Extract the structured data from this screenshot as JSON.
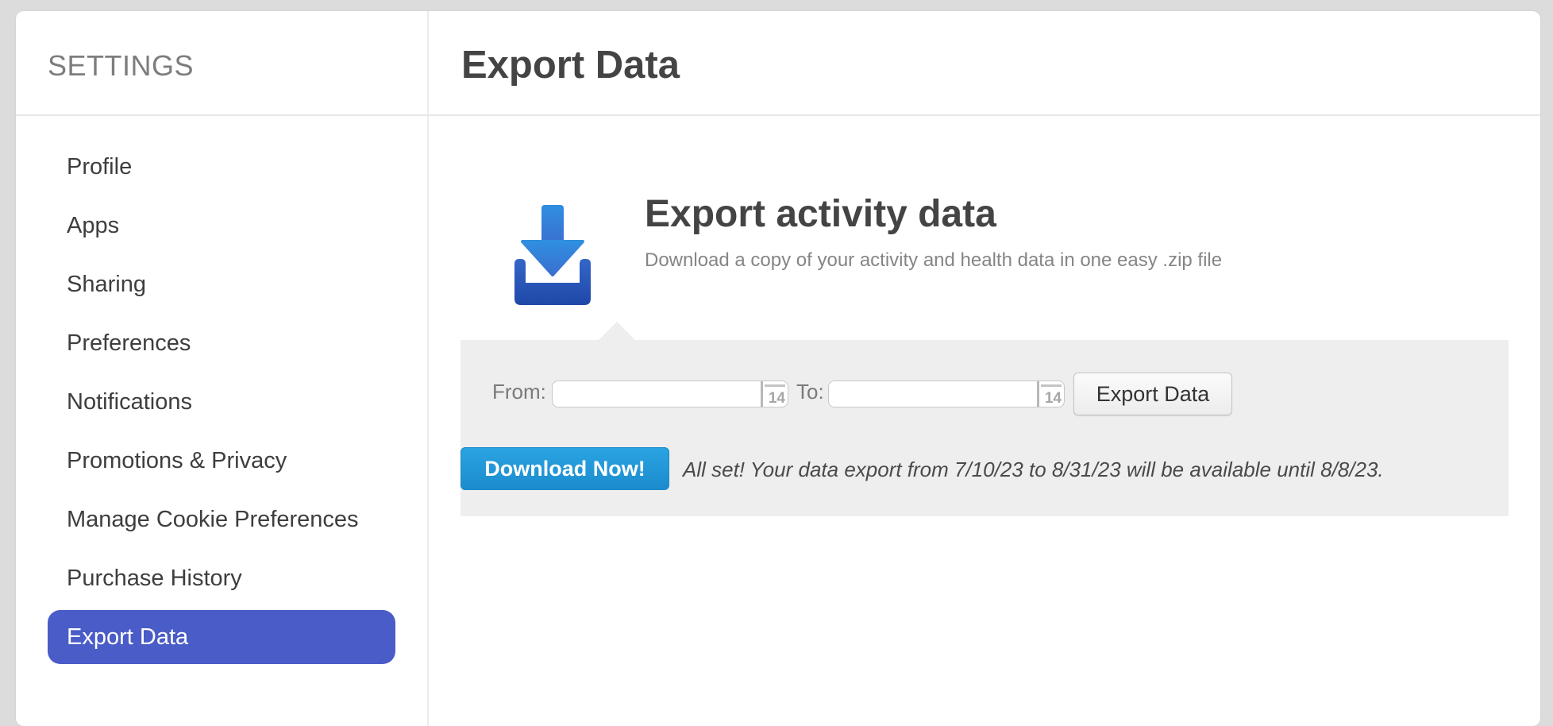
{
  "sidebar": {
    "title": "SETTINGS",
    "items": [
      {
        "label": "Profile",
        "active": false
      },
      {
        "label": "Apps",
        "active": false
      },
      {
        "label": "Sharing",
        "active": false
      },
      {
        "label": "Preferences",
        "active": false
      },
      {
        "label": "Notifications",
        "active": false
      },
      {
        "label": "Promotions & Privacy",
        "active": false
      },
      {
        "label": "Manage Cookie Preferences",
        "active": false
      },
      {
        "label": "Purchase History",
        "active": false
      },
      {
        "label": "Export Data",
        "active": true
      }
    ],
    "active_color": "#4a5cc8"
  },
  "header": {
    "title": "Export Data"
  },
  "main": {
    "icon": "download-icon",
    "heading": "Export activity data",
    "subheading": "Download a copy of your activity and health data in one easy .zip file",
    "form": {
      "from_label": "From:",
      "from_value": "",
      "to_label": "To:",
      "to_value": "",
      "calendar_icon_day": "14",
      "export_button": "Export Data"
    },
    "download_button": "Download Now!",
    "status_message": "All set! Your data export from 7/10/23 to 8/31/23 will be available until 8/8/23."
  },
  "colors": {
    "accent": "#4a5cc8",
    "download_button": "#1e96d6",
    "icon_blue": "#2f6fd0"
  }
}
